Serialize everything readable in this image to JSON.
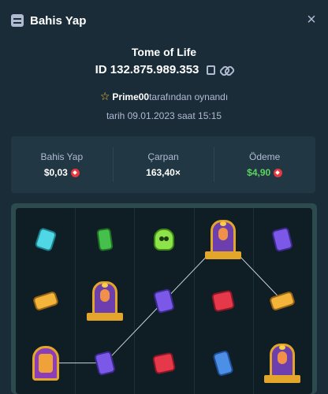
{
  "header": {
    "title": "Bahis Yap",
    "close": "×"
  },
  "game": {
    "title": "Tome of Life",
    "bet_id": "ID 132.875.989.353"
  },
  "player": {
    "name": "Prime00",
    "played_by_suffix": "tarafından oynandı"
  },
  "date_line": "tarih 09.01.2023 saat 15:15",
  "stats": {
    "bet": {
      "label": "Bahis Yap",
      "value": "$0,03"
    },
    "multiplier": {
      "label": "Çarpan",
      "value": "163,40×"
    },
    "payout": {
      "label": "Ödeme",
      "value": "$4,90"
    }
  },
  "colors": {
    "background": "#1a2c38",
    "panel": "#213743",
    "muted_text": "#b1bad3",
    "payout_green": "#5ed35e",
    "currency_red": "#e8373e"
  },
  "board": {
    "columns": 5,
    "rows": 3,
    "grid": [
      [
        "gem-cyan",
        "gem-green",
        "skull-wild",
        "book-scatter",
        "gem-purple"
      ],
      [
        "gem-yellow",
        "book-scatter",
        "gem-purple",
        "gem-red",
        "gem-yellow"
      ],
      [
        "scroll-bonus",
        "gem-purple",
        "gem-red",
        "gem-blue",
        "book-scatter"
      ]
    ],
    "win_line_cells": [
      [
        2,
        0
      ],
      [
        2,
        1
      ],
      [
        1,
        2
      ],
      [
        0,
        3
      ],
      [
        1,
        4
      ]
    ]
  }
}
